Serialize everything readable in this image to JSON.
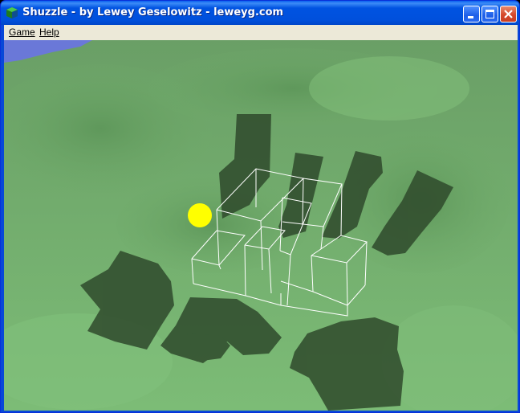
{
  "window": {
    "title": "Shuzzle - by Lewey Geselowitz - leweyg.com"
  },
  "menu": {
    "game_label": "Game",
    "help_label": "Help"
  },
  "colors": {
    "titlebar": "#0054e3",
    "menubar": "#ece9d8",
    "terrain": "#6faa6a",
    "shadow": "#2f4a2c",
    "wireframe": "#ffffff",
    "ball": "#ffff00",
    "sky": "#6a78d8"
  }
}
